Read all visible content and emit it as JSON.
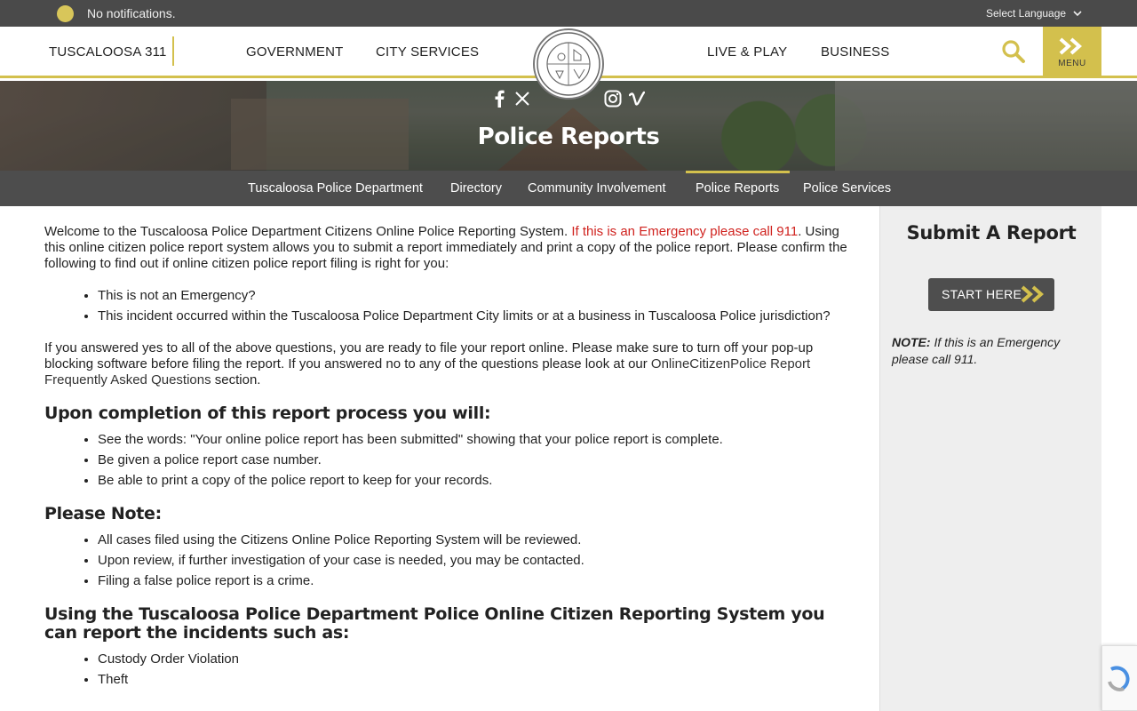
{
  "notification": {
    "text": "No notifications."
  },
  "language": {
    "label": "Select Language"
  },
  "header": {
    "nav": {
      "t311": "TUSCALOOSA 311",
      "government": "GOVERNMENT",
      "city_services": "CITY SERVICES",
      "live_play": "LIVE & PLAY",
      "business": "BUSINESS"
    },
    "menu_label": "MENU"
  },
  "hero": {
    "title": "Police Reports"
  },
  "subnav": {
    "items": [
      "Tuscaloosa Police Department",
      "Directory",
      "Community Involvement",
      "Police Reports",
      "Police Services"
    ]
  },
  "content": {
    "intro1": "Welcome to the Tuscaloosa Police Department Citizens Online Police Reporting System. ",
    "intro_emergency": "If this is an Emergency please call 911",
    "intro2": ". Using this online citizen police report system allows you to submit a report immediately and print a copy of the police report. Please confirm the following to find out if online citizen police report filing is right for you:",
    "confirm_items": [
      "This is not an Emergency?",
      "This incident occurred within the Tuscaloosa Police Department City limits or at a business in Tuscaloosa Police jurisdiction?"
    ],
    "answered1": "If you answered yes to all of the above questions, you are ready to file your report online. Please make sure to turn off your pop-up blocking software before filing the report. If you answered no to any of the questions please look at our ",
    "answered_link": "OnlineCitizenPolice Report Frequently Asked Questions",
    "answered2": " section.",
    "completion_heading": "Upon completion of this report process you will:",
    "completion_items": [
      "See the words: \"Your online police report has been submitted\" showing that your police report is complete.",
      "Be given a police report case number.",
      "Be able to print a copy of the police report to keep for your records."
    ],
    "note_heading": "Please Note:",
    "note_items": [
      "All cases filed using the Citizens Online Police Reporting System will be reviewed.",
      "Upon review, if further investigation of your case is needed, you may be contacted.",
      "Filing a false police report is a crime."
    ],
    "incidents_heading": "Using the Tuscaloosa Police Department Police Online Citizen Reporting System you can report the incidents such as:",
    "incident_items": [
      "Custody Order Violation",
      "Theft"
    ]
  },
  "sidebar": {
    "title": "Submit A Report",
    "button": "START HERE",
    "note_label": "NOTE:",
    "note_text": " If this is an Emergency please call 911."
  },
  "colors": {
    "accent": "#d3c04d",
    "dark_bar": "#4a4a4a",
    "emergency": "#d0231f"
  }
}
